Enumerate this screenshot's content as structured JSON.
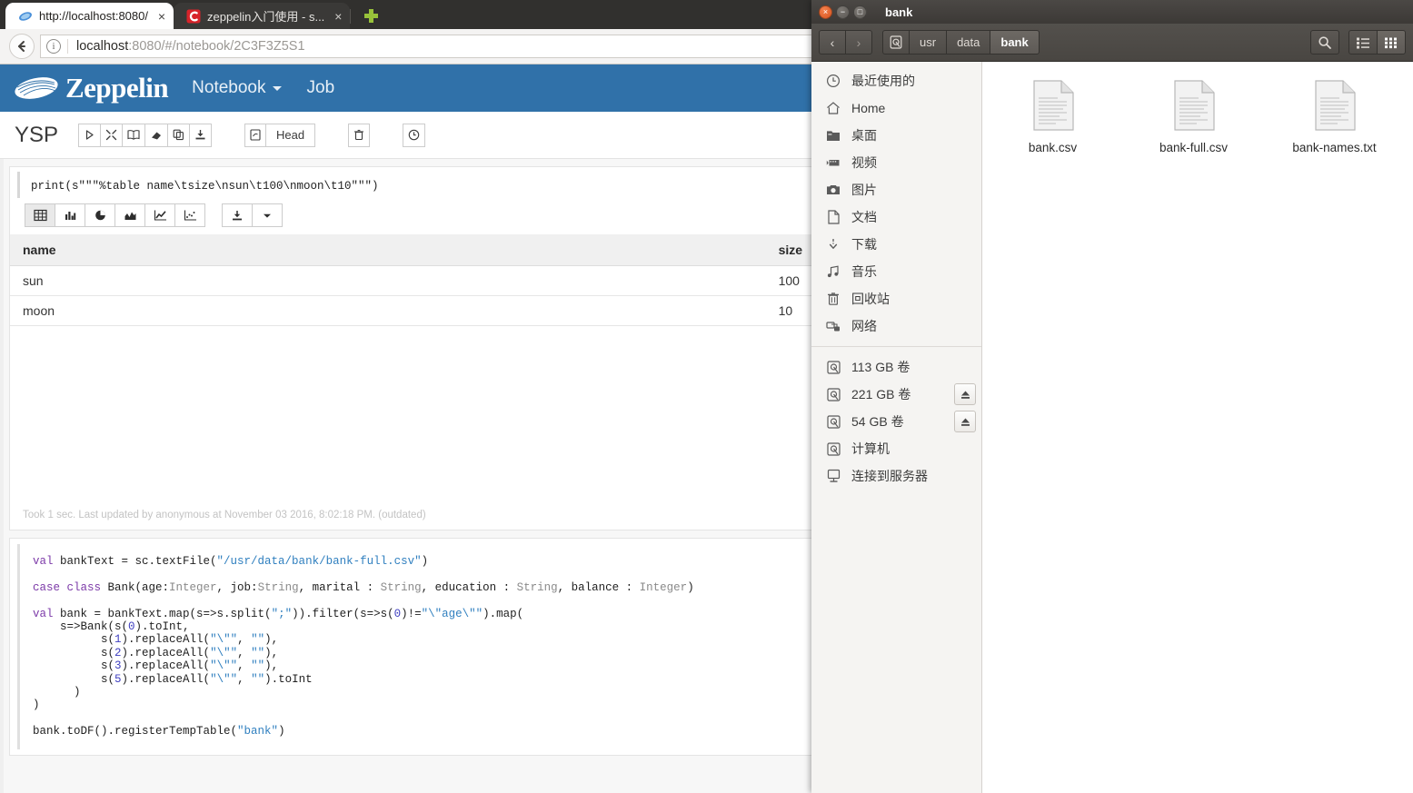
{
  "browser": {
    "tabs": [
      {
        "title": "http://localhost:8080/",
        "favicon": "zeppelin-icon",
        "close": "×",
        "active": true
      },
      {
        "title": "zeppelin入门使用 - s...",
        "favicon": "csdn-icon",
        "close": "×",
        "active": false
      }
    ],
    "new_tab_label": "+",
    "back_label": "←",
    "url": {
      "host": "localhost",
      "rest": ":8080/#/notebook/2C3F3Z5S1",
      "info_glyph": "i"
    }
  },
  "zeppelin": {
    "brand": "Zeppelin",
    "nav": [
      {
        "label": "Notebook",
        "has_caret": true
      },
      {
        "label": "Job",
        "has_caret": false
      }
    ],
    "notebook_title": "YSP",
    "toolbar": {
      "run_all": "▷",
      "collapse_all": "✕",
      "show_hide_code": "📖",
      "clear_output": "◥",
      "clone": "⧉",
      "export": "⤓",
      "version_icon": "⎘",
      "version_label": "Head",
      "trash": "🗑",
      "schedule": "⊙"
    },
    "paragraph1": {
      "code": "print(s\"\"\"%table name\\tsize\\nsun\\t100\\nmoon\\t10\"\"\")",
      "viz_buttons": [
        {
          "name": "table",
          "active": true
        },
        {
          "name": "bar-chart",
          "active": false
        },
        {
          "name": "pie-chart",
          "active": false
        },
        {
          "name": "area-chart",
          "active": false
        },
        {
          "name": "line-chart",
          "active": false
        },
        {
          "name": "scatter-chart",
          "active": false
        }
      ],
      "download_label": "⤓",
      "download_caret": "▾",
      "table": {
        "columns": [
          "name",
          "size"
        ],
        "rows": [
          [
            "sun",
            "100"
          ],
          [
            "moon",
            "10"
          ]
        ]
      },
      "footer": "Took 1 sec. Last updated by anonymous at November 03 2016, 8:02:18 PM. (outdated)"
    },
    "paragraph2": {
      "lines": [
        [
          {
            "t": "val ",
            "c": "kw"
          },
          {
            "t": "bankText = sc.textFile(",
            "c": ""
          },
          {
            "t": "\"/usr/data/bank/bank-full.csv\"",
            "c": "str"
          },
          {
            "t": ")",
            "c": ""
          }
        ],
        [
          {
            "t": "",
            "c": ""
          }
        ],
        [
          {
            "t": "case class ",
            "c": "kw"
          },
          {
            "t": "Bank(age:",
            "c": ""
          },
          {
            "t": "Integer",
            "c": "typ"
          },
          {
            "t": ", job:",
            "c": ""
          },
          {
            "t": "String",
            "c": "typ"
          },
          {
            "t": ", marital : ",
            "c": ""
          },
          {
            "t": "String",
            "c": "typ"
          },
          {
            "t": ", education : ",
            "c": ""
          },
          {
            "t": "String",
            "c": "typ"
          },
          {
            "t": ", balance : ",
            "c": ""
          },
          {
            "t": "Integer",
            "c": "typ"
          },
          {
            "t": ")",
            "c": ""
          }
        ],
        [
          {
            "t": "",
            "c": ""
          }
        ],
        [
          {
            "t": "val ",
            "c": "kw"
          },
          {
            "t": "bank = bankText.map(s=>s.split(",
            "c": ""
          },
          {
            "t": "\";\"",
            "c": "str"
          },
          {
            "t": ")).filter(s=>s(",
            "c": ""
          },
          {
            "t": "0",
            "c": "num"
          },
          {
            "t": ")!=",
            "c": ""
          },
          {
            "t": "\"\\\"age\\\"\"",
            "c": "str"
          },
          {
            "t": ").map(",
            "c": ""
          }
        ],
        [
          {
            "t": "    s=>Bank(s(",
            "c": ""
          },
          {
            "t": "0",
            "c": "num"
          },
          {
            "t": ").toInt,",
            "c": ""
          }
        ],
        [
          {
            "t": "          s(",
            "c": ""
          },
          {
            "t": "1",
            "c": "num"
          },
          {
            "t": ").replaceAll(",
            "c": ""
          },
          {
            "t": "\"\\\"\"",
            "c": "str"
          },
          {
            "t": ", ",
            "c": ""
          },
          {
            "t": "\"\"",
            "c": "str"
          },
          {
            "t": "),",
            "c": ""
          }
        ],
        [
          {
            "t": "          s(",
            "c": ""
          },
          {
            "t": "2",
            "c": "num"
          },
          {
            "t": ").replaceAll(",
            "c": ""
          },
          {
            "t": "\"\\\"\"",
            "c": "str"
          },
          {
            "t": ", ",
            "c": ""
          },
          {
            "t": "\"\"",
            "c": "str"
          },
          {
            "t": "),",
            "c": ""
          }
        ],
        [
          {
            "t": "          s(",
            "c": ""
          },
          {
            "t": "3",
            "c": "num"
          },
          {
            "t": ").replaceAll(",
            "c": ""
          },
          {
            "t": "\"\\\"\"",
            "c": "str"
          },
          {
            "t": ", ",
            "c": ""
          },
          {
            "t": "\"\"",
            "c": "str"
          },
          {
            "t": "),",
            "c": ""
          }
        ],
        [
          {
            "t": "          s(",
            "c": ""
          },
          {
            "t": "5",
            "c": "num"
          },
          {
            "t": ").replaceAll(",
            "c": ""
          },
          {
            "t": "\"\\\"\"",
            "c": "str"
          },
          {
            "t": ", ",
            "c": ""
          },
          {
            "t": "\"\"",
            "c": "str"
          },
          {
            "t": ").toInt",
            "c": ""
          }
        ],
        [
          {
            "t": "      )",
            "c": ""
          }
        ],
        [
          {
            "t": ")",
            "c": ""
          }
        ],
        [
          {
            "t": "",
            "c": ""
          }
        ],
        [
          {
            "t": "bank.toDF().registerTempTable(",
            "c": ""
          },
          {
            "t": "\"bank\"",
            "c": "str"
          },
          {
            "t": ")",
            "c": ""
          }
        ]
      ]
    }
  },
  "filemanager": {
    "window_title": "bank",
    "window_buttons": {
      "close": "×",
      "minimize": "−",
      "maximize": "□"
    },
    "nav": {
      "back": "‹",
      "forward": "›"
    },
    "breadcrumbs": [
      {
        "label": "",
        "icon": "device-icon",
        "current": false
      },
      {
        "label": "usr",
        "current": false
      },
      {
        "label": "data",
        "current": false
      },
      {
        "label": "bank",
        "current": true
      }
    ],
    "actions": {
      "search": "search-icon",
      "list_view": "list-view-icon",
      "icon_view": "icon-view-icon"
    },
    "sidebar": {
      "places": [
        {
          "label": "最近使用的",
          "icon": "clock-icon"
        },
        {
          "label": "Home",
          "icon": "home-icon"
        },
        {
          "label": "桌面",
          "icon": "desktop-folder-icon"
        },
        {
          "label": "视频",
          "icon": "video-icon"
        },
        {
          "label": "图片",
          "icon": "camera-icon"
        },
        {
          "label": "文档",
          "icon": "document-icon"
        },
        {
          "label": "下载",
          "icon": "download-icon"
        },
        {
          "label": "音乐",
          "icon": "music-icon"
        },
        {
          "label": "回收站",
          "icon": "trash-icon"
        },
        {
          "label": "网络",
          "icon": "network-icon"
        }
      ],
      "devices": [
        {
          "label": "113 GB 卷",
          "icon": "drive-icon",
          "eject": false
        },
        {
          "label": "221 GB 卷",
          "icon": "drive-icon",
          "eject": true
        },
        {
          "label": "54 GB 卷",
          "icon": "drive-icon",
          "eject": true
        },
        {
          "label": "计算机",
          "icon": "computer-icon",
          "eject": false
        },
        {
          "label": "连接到服务器",
          "icon": "connect-server-icon",
          "eject": false
        }
      ]
    },
    "files": [
      {
        "name": "bank.csv",
        "icon": "text-file-icon"
      },
      {
        "name": "bank-full.csv",
        "icon": "text-file-icon"
      },
      {
        "name": "bank-names.txt",
        "icon": "text-file-icon"
      }
    ]
  },
  "colors": {
    "zeppelin_blue": "#3071a9",
    "browser_chrome": "#31302e",
    "fm_chrome": "#494642",
    "accent_green": "#98c23a"
  }
}
